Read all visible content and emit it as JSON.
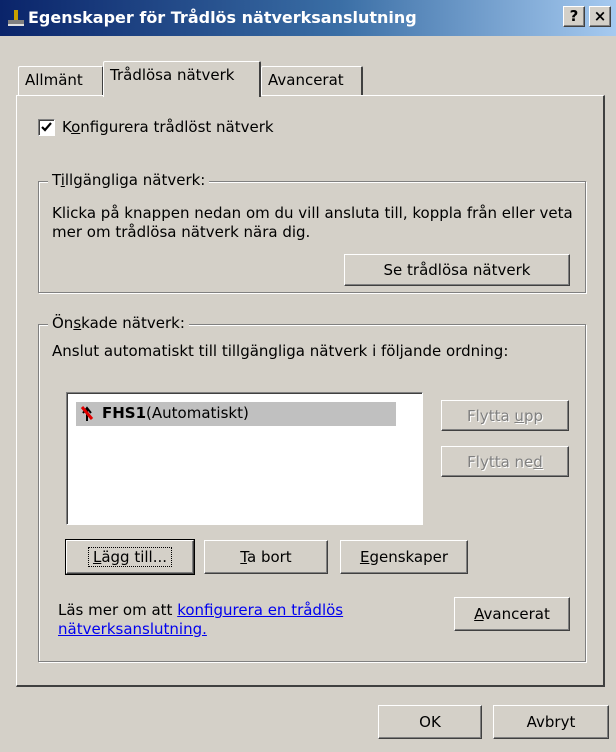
{
  "window": {
    "title": "Egenskaper för Trådlös nätverksanslutning",
    "help_label": "?",
    "close_label": "×"
  },
  "tabs": [
    {
      "label": "Allmänt",
      "active": false
    },
    {
      "label": "Trådlösa nätverk",
      "active": true
    },
    {
      "label": "Avancerat",
      "active": false
    }
  ],
  "configure": {
    "checked": true,
    "label_pre": "K",
    "label_accel": "o",
    "label_post": "nfigurera trådlöst nätverk"
  },
  "available": {
    "legend_pre": "T",
    "legend_accel": "i",
    "legend_post": "llgängliga nätverk:",
    "description": "Klicka på knappen nedan om du vill ansluta till, koppla från eller veta mer om trådlösa nätverk nära dig.",
    "view_button": "Se trådlösa nätverk"
  },
  "preferred": {
    "legend_pre": "Ön",
    "legend_accel": "s",
    "legend_post": "kade nätverk:",
    "description": "Anslut automatiskt till tillgängliga nätverk i följande ordning:",
    "networks": [
      {
        "name": "FHS1",
        "mode": "(Automatiskt)"
      }
    ],
    "move_up_pre": "Flytta ",
    "move_up_accel": "u",
    "move_up_post": "pp",
    "move_down_pre": "Flytta ne",
    "move_down_accel": "d",
    "move_down_post": "",
    "add_pre": "",
    "add_accel": "L",
    "add_post": "ägg till...",
    "remove_pre": "",
    "remove_accel": "T",
    "remove_post": "a bort",
    "properties_pre": "",
    "properties_accel": "E",
    "properties_post": "genskaper",
    "learn_text": "Läs mer om att ",
    "learn_link": "konfigurera en trådlös nätverksanslutning.",
    "advanced_pre": "",
    "advanced_accel": "A",
    "advanced_post": "vancerat"
  },
  "footer": {
    "ok": "OK",
    "cancel": "Avbryt"
  },
  "icons": {
    "title_icon": "network-connection-icon",
    "network_icon": "wireless-network-icon"
  }
}
